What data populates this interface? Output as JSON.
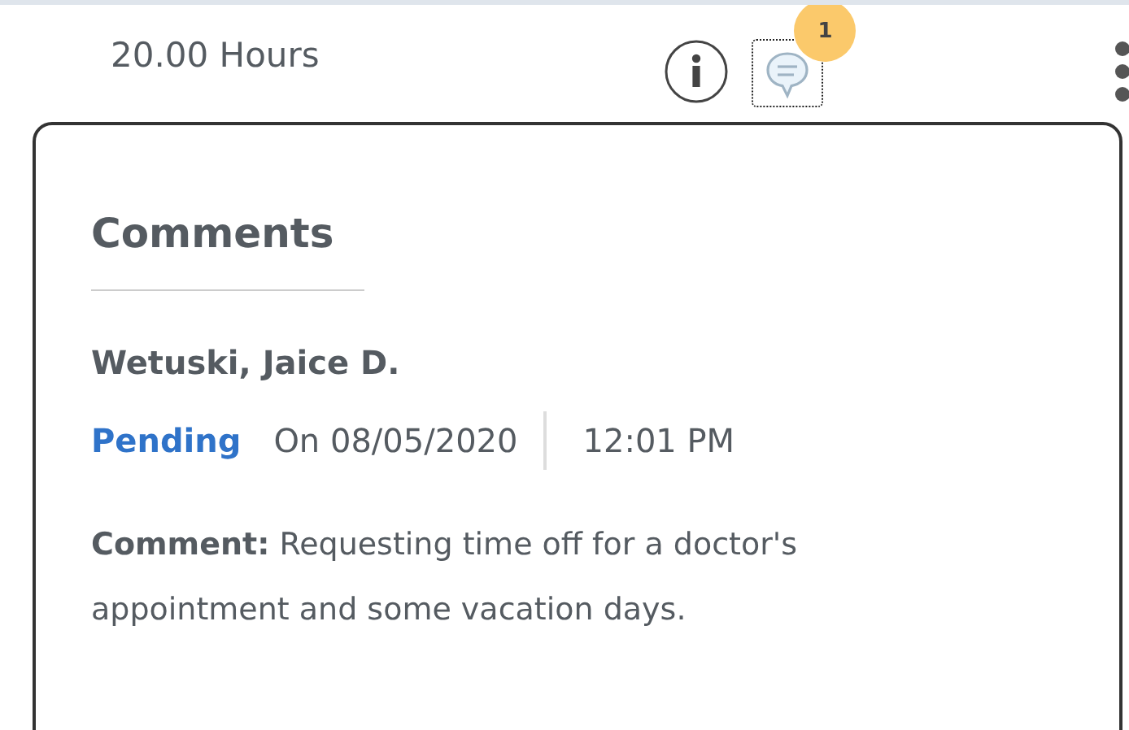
{
  "row": {
    "hours": "20.00 Hours",
    "comment_count": "1"
  },
  "popover": {
    "title": "Comments",
    "comments": [
      {
        "author": "Wetuski, Jaice D.",
        "status": {
          "label": "Pending",
          "kind": "pending"
        },
        "date": "On 08/05/2020",
        "time": "12:01 PM",
        "text": "**Comment:** Requesting time off for a doctor's appointment and some vacation days."
      }
    ]
  }
}
